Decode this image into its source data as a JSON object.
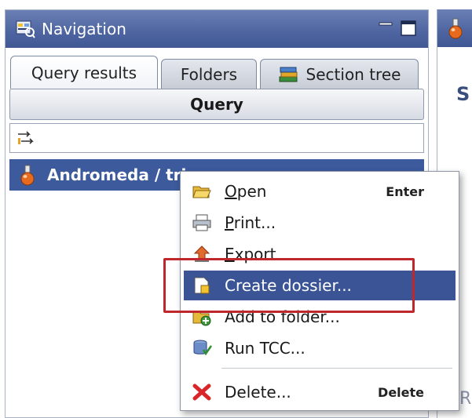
{
  "navigation": {
    "title": "Navigation",
    "icon": "navigation-icon",
    "window_controls": [
      "minimize-icon",
      "maximize-icon"
    ]
  },
  "tabs": [
    {
      "label": "Query results",
      "active": true
    },
    {
      "label": "Folders",
      "active": false
    },
    {
      "label": "Section tree",
      "icon": "books-icon",
      "active": false
    }
  ],
  "query": {
    "label": "Query"
  },
  "filter": {
    "icon": "filter-arrows-icon"
  },
  "result_row": {
    "label": "Andromeda / tri",
    "icon": "flask-icon"
  },
  "context_menu": {
    "items": [
      {
        "label_underline": "O",
        "label_rest": "pen",
        "accelerator": "Enter",
        "icon": "folder-open-icon"
      },
      {
        "label_underline": "P",
        "label_rest": "rint...",
        "accelerator": "",
        "icon": "printer-icon"
      },
      {
        "label_underline": "E",
        "label_rest": "xport",
        "accelerator": "",
        "icon": "export-icon"
      },
      {
        "label_full": "Create dossier...",
        "accelerator": "",
        "icon": "dossier-icon",
        "selected": true
      },
      {
        "label_full": "Add to folder...",
        "accelerator": "",
        "icon": "add-folder-icon"
      },
      {
        "label_full": "Run TCC...",
        "accelerator": "",
        "icon": "run-tcc-icon"
      },
      {
        "label_full": "Delete...",
        "accelerator": "Delete",
        "icon": "delete-icon"
      }
    ]
  },
  "right_panel": {
    "letter_top": "S",
    "letter_bottom": "R",
    "icon": "flask-icon"
  },
  "colors": {
    "header_blue": "#4f66a2",
    "selection_blue": "#3a5496",
    "highlight_red": "#c0272d"
  }
}
